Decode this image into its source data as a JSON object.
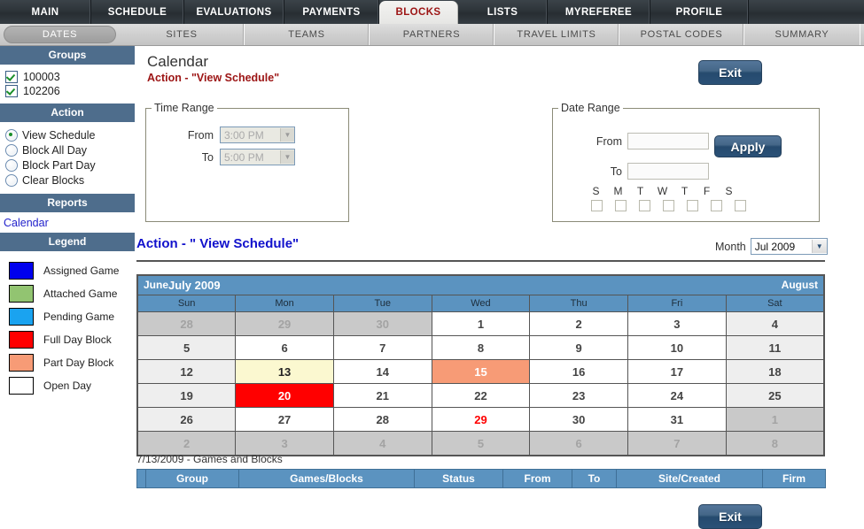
{
  "topnav": {
    "tabs": [
      {
        "label": "MAIN",
        "active": false
      },
      {
        "label": "SCHEDULE",
        "active": false
      },
      {
        "label": "EVALUATIONS",
        "active": false
      },
      {
        "label": "PAYMENTS",
        "active": false
      },
      {
        "label": "BLOCKS",
        "active": true
      },
      {
        "label": "LISTS",
        "active": false
      },
      {
        "label": "MYREFEREE",
        "active": false
      },
      {
        "label": "PROFILE",
        "active": false
      }
    ]
  },
  "subnav": {
    "tabs": [
      {
        "label": "DATES",
        "active": true
      },
      {
        "label": "SITES",
        "active": false
      },
      {
        "label": "TEAMS",
        "active": false
      },
      {
        "label": "PARTNERS",
        "active": false
      },
      {
        "label": "TRAVEL LIMITS",
        "active": false
      },
      {
        "label": "POSTAL CODES",
        "active": false
      },
      {
        "label": "SUMMARY",
        "active": false
      }
    ]
  },
  "sidebar": {
    "groups": {
      "title": "Groups",
      "items": [
        {
          "label": "100003",
          "checked": true
        },
        {
          "label": "102206",
          "checked": true
        }
      ]
    },
    "action": {
      "title": "Action",
      "options": [
        {
          "label": "View Schedule",
          "selected": true
        },
        {
          "label": "Block All Day",
          "selected": false
        },
        {
          "label": "Block Part Day",
          "selected": false
        },
        {
          "label": "Clear Blocks",
          "selected": false
        }
      ]
    },
    "reports": {
      "title": "Reports",
      "links": [
        {
          "label": "Calendar"
        }
      ]
    },
    "legend": {
      "title": "Legend",
      "items": [
        {
          "label": "Assigned Game",
          "color": "#0000ee"
        },
        {
          "label": "Attached Game",
          "color": "#92c471"
        },
        {
          "label": "Pending Game",
          "color": "#1aa3f0"
        },
        {
          "label": "Full Day Block",
          "color": "#ff0000"
        },
        {
          "label": "Part Day Block",
          "color": "#f79b76"
        },
        {
          "label": "Open Day",
          "color": "#ffffff"
        }
      ]
    }
  },
  "main": {
    "page_title": "Calendar",
    "action_red": "Action - \"View Schedule\"",
    "action_blue": "Action - \" View Schedule\"",
    "exit_top_label": "Exit",
    "exit_bottom_label": "Exit",
    "time_range": {
      "legend": "Time Range",
      "from_label": "From",
      "from_value": "3:00 PM",
      "to_label": "To",
      "to_value": "5:00 PM"
    },
    "date_range": {
      "legend": "Date Range",
      "from_label": "From",
      "from_value": "",
      "to_label": "To",
      "to_value": "",
      "apply_label": "Apply",
      "dow_labels": [
        "S",
        "M",
        "T",
        "W",
        "T",
        "F",
        "S"
      ]
    },
    "month_picker": {
      "label": "Month",
      "value": "Jul 2009"
    }
  },
  "calendar": {
    "prev_month": "June",
    "title": "July 2009",
    "next_month": "August",
    "day_headers": [
      "Sun",
      "Mon",
      "Tue",
      "Wed",
      "Thu",
      "Fri",
      "Sat"
    ],
    "weeks": [
      [
        {
          "n": "28",
          "state": "out"
        },
        {
          "n": "29",
          "state": "out"
        },
        {
          "n": "30",
          "state": "out"
        },
        {
          "n": "1",
          "state": "open"
        },
        {
          "n": "2",
          "state": "open"
        },
        {
          "n": "3",
          "state": "open"
        },
        {
          "n": "4",
          "state": "weekend"
        }
      ],
      [
        {
          "n": "5",
          "state": "weekend"
        },
        {
          "n": "6",
          "state": "open"
        },
        {
          "n": "7",
          "state": "open"
        },
        {
          "n": "8",
          "state": "open"
        },
        {
          "n": "9",
          "state": "open"
        },
        {
          "n": "10",
          "state": "open"
        },
        {
          "n": "11",
          "state": "weekend"
        }
      ],
      [
        {
          "n": "12",
          "state": "weekend"
        },
        {
          "n": "13",
          "state": "selected"
        },
        {
          "n": "14",
          "state": "open"
        },
        {
          "n": "15",
          "state": "part"
        },
        {
          "n": "16",
          "state": "open"
        },
        {
          "n": "17",
          "state": "open"
        },
        {
          "n": "18",
          "state": "weekend"
        }
      ],
      [
        {
          "n": "19",
          "state": "weekend"
        },
        {
          "n": "20",
          "state": "full"
        },
        {
          "n": "21",
          "state": "open"
        },
        {
          "n": "22",
          "state": "open"
        },
        {
          "n": "23",
          "state": "open"
        },
        {
          "n": "24",
          "state": "open"
        },
        {
          "n": "25",
          "state": "weekend"
        }
      ],
      [
        {
          "n": "26",
          "state": "weekend"
        },
        {
          "n": "27",
          "state": "open"
        },
        {
          "n": "28",
          "state": "open"
        },
        {
          "n": "29",
          "state": "open-red"
        },
        {
          "n": "30",
          "state": "open"
        },
        {
          "n": "31",
          "state": "open"
        },
        {
          "n": "1",
          "state": "out"
        }
      ],
      [
        {
          "n": "2",
          "state": "out"
        },
        {
          "n": "3",
          "state": "out"
        },
        {
          "n": "4",
          "state": "out"
        },
        {
          "n": "5",
          "state": "out"
        },
        {
          "n": "6",
          "state": "out"
        },
        {
          "n": "7",
          "state": "out"
        },
        {
          "n": "8",
          "state": "out"
        }
      ]
    ]
  },
  "games_table": {
    "caption": "7/13/2009 - Games and Blocks",
    "columns": [
      "",
      "Group",
      "Games/Blocks",
      "Status",
      "From",
      "To",
      "Site/Created",
      "Firm"
    ],
    "rows": []
  }
}
